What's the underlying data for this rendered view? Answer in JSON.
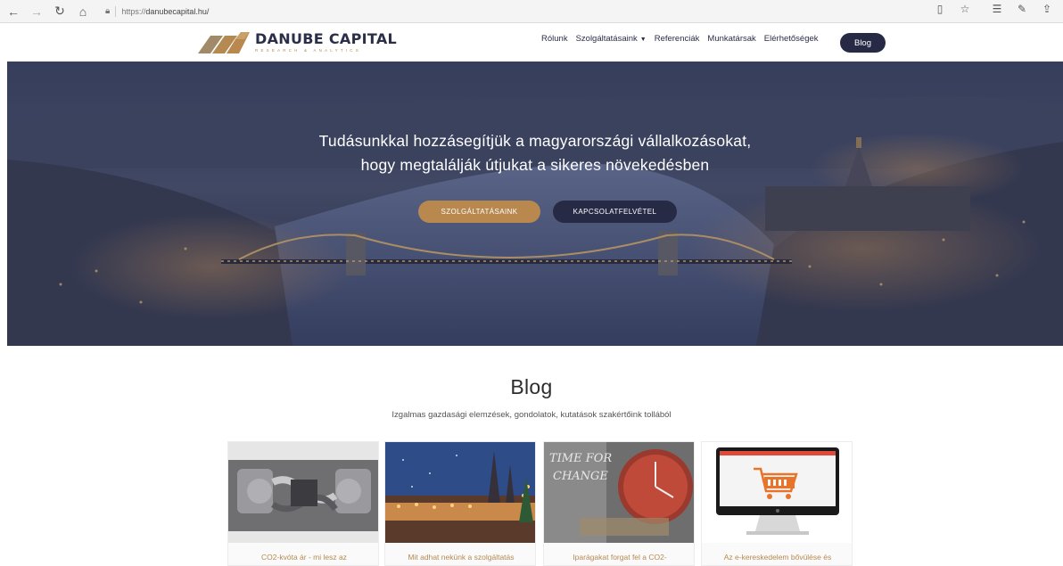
{
  "browser": {
    "url_prefix": "https://",
    "url_host": "danubecapital.hu/",
    "icons": [
      "back-icon",
      "forward-icon",
      "refresh-icon",
      "home-icon",
      "lock-icon",
      "reading-view-icon",
      "favorite-star-icon",
      "favorites-list-icon",
      "pen-icon",
      "share-icon"
    ]
  },
  "header": {
    "brand": "DANUBE CAPITAL",
    "tagline": "RESEARCH & ANALYTICS",
    "nav": [
      "Rólunk",
      "Szolgáltatásaink",
      "Referenciák",
      "Munkatársak",
      "Elérhetőségek"
    ],
    "blog_button": "Blog"
  },
  "hero": {
    "line1": "Tudásunkkal hozzásegítjük a magyarországi vállalkozásokat,",
    "line2": "hogy megtalálják útjukat a sikeres növekedésben",
    "btn_services": "SZOLGÁLTATÁSAINK",
    "btn_contact": "KAPCSOLATFELVÉTEL"
  },
  "blog": {
    "title": "Blog",
    "subtitle": "Izgalmas gazdasági elemzések, gondolatok, kutatások szakértőink tollából",
    "cards": [
      {
        "caption": "CO2-kvóta ár - mi lesz az",
        "image": "car-engine-photo"
      },
      {
        "caption": "Mit adhat nekünk a szolgáltatás",
        "image": "christmas-market-photo"
      },
      {
        "caption": "Iparágakat forgat fel a CO2-",
        "image": "time-for-change-clock-photo",
        "image_text": "TIME FOR CHANGE"
      },
      {
        "caption": "Az e-kereskedelem bővülése és",
        "image": "shopping-cart-monitor-photo"
      }
    ]
  },
  "colors": {
    "accent_gold": "#b8884f",
    "navy": "#262a45"
  }
}
